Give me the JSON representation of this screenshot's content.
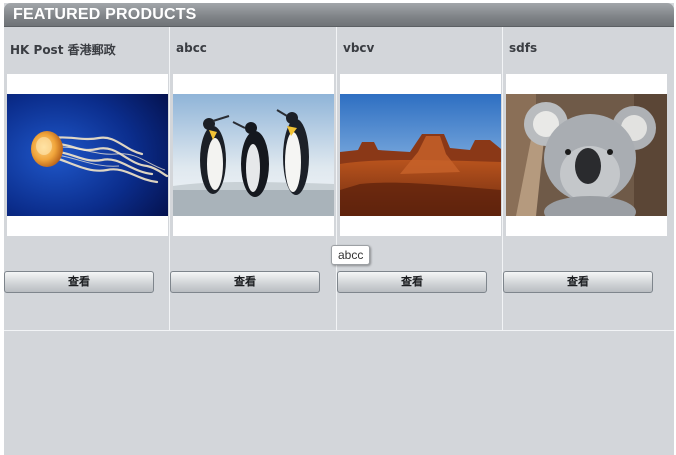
{
  "section": {
    "title": "FEATURED PRODUCTS"
  },
  "products": [
    {
      "name": "HK Post 香港郵政",
      "image": "jellyfish-photo",
      "button_label": "查看"
    },
    {
      "name": "abcc",
      "image": "penguins-photo",
      "button_label": "查看"
    },
    {
      "name": "vbcv",
      "image": "desert-mesa-photo",
      "button_label": "查看"
    },
    {
      "name": "sdfs",
      "image": "koala-photo",
      "button_label": "查看"
    }
  ],
  "tooltip": {
    "text": "abcc"
  },
  "colors": {
    "panel_background": "#d3d6da",
    "header_gradient_top": "#a2a6aa",
    "header_gradient_bottom": "#6f7377",
    "divider": "#f2f4f6"
  }
}
